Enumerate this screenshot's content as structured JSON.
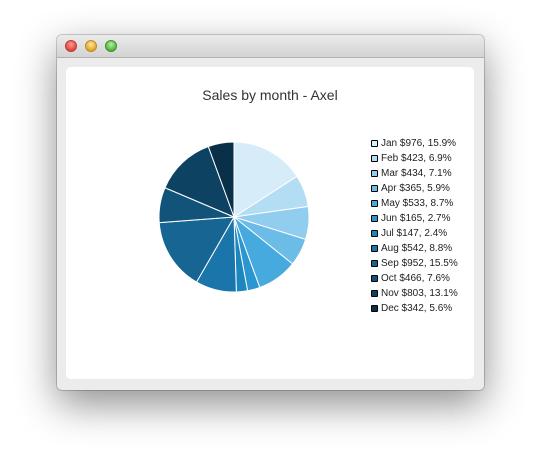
{
  "window": {
    "controls": [
      "close-button",
      "minimize-button",
      "zoom-button"
    ]
  },
  "chart_data": {
    "type": "pie",
    "title": "Sales by month - Axel",
    "categories": [
      "Jan",
      "Feb",
      "Mar",
      "Apr",
      "May",
      "Jun",
      "Jul",
      "Aug",
      "Sep",
      "Oct",
      "Nov",
      "Dec"
    ],
    "values": [
      976,
      423,
      434,
      365,
      533,
      165,
      147,
      542,
      952,
      466,
      803,
      342
    ],
    "percentages": [
      15.9,
      6.9,
      7.1,
      5.9,
      8.7,
      2.7,
      2.4,
      8.8,
      15.5,
      7.6,
      13.1,
      5.6
    ],
    "legend": [
      "Jan $976, 15.9%",
      "Feb $423, 6.9%",
      "Mar $434, 7.1%",
      "Apr $365, 5.9%",
      "May $533, 8.7%",
      "Jun $165, 2.7%",
      "Jul $147, 2.4%",
      "Aug $542, 8.8%",
      "Sep $952, 15.5%",
      "Oct $466, 7.6%",
      "Nov $803, 13.1%",
      "Dec $342, 5.6%"
    ],
    "colors": [
      "#d6ecf9",
      "#b3ddf3",
      "#90cdee",
      "#6bbce7",
      "#47aadf",
      "#2b96d0",
      "#1e86bf",
      "#1a76aa",
      "#166593",
      "#12537a",
      "#0e4262",
      "#0a3049"
    ],
    "legend_position": "right",
    "start_angle": "12 o'clock",
    "direction": "clockwise"
  }
}
